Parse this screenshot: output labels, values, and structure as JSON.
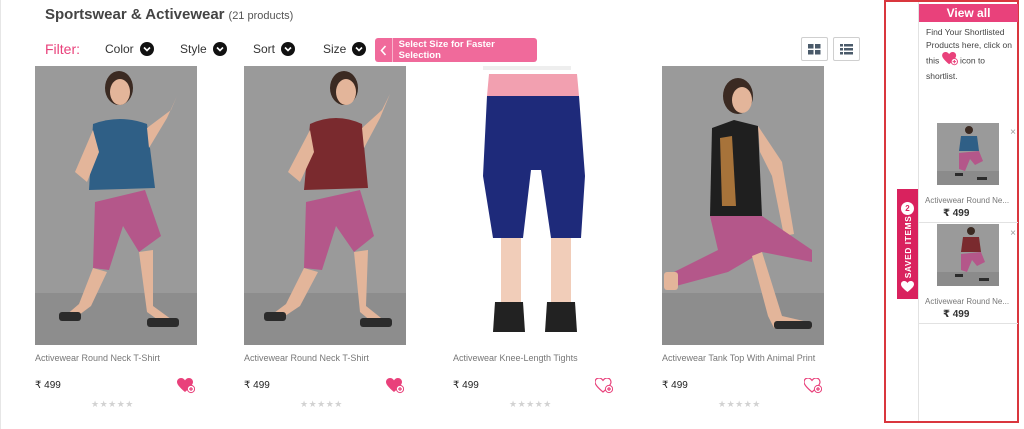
{
  "header": {
    "title": "Sportswear & Activewear",
    "count": "(21 products)"
  },
  "filters": {
    "label": "Filter:",
    "items": [
      "Color",
      "Style",
      "Sort",
      "Size"
    ],
    "size_tip": "Select Size for Faster Selection"
  },
  "view_toggle": {
    "grid_icon": "grid-view-icon",
    "list_icon": "list-view-icon"
  },
  "products": [
    {
      "name": "Activewear Round Neck T-Shirt",
      "price": "₹ 499",
      "rating": "★★★★★",
      "top_color": "#2f5f86",
      "bottom_color": "#b4578a"
    },
    {
      "name": "Activewear Round Neck T-Shirt",
      "price": "₹ 499",
      "rating": "★★★★★",
      "top_color": "#7a2a2e",
      "bottom_color": "#b4578a"
    },
    {
      "name": "Activewear Knee-Length Tights",
      "price": "₹ 499",
      "rating": "★★★★★",
      "top_color": "#f2a0b0",
      "bottom_color": "#1e2a7a"
    },
    {
      "name": "Activewear Tank Top With Animal Print",
      "price": "₹ 499",
      "rating": "★★★★★",
      "top_color": "#1f1f1f",
      "bottom_color": "#b4578a"
    }
  ],
  "shortlist": {
    "view_all": "View all",
    "help_text_1": "Find Your Shortlisted Products here, click on this",
    "help_text_2": "icon to shortlist.",
    "saved_tab_label": "SAVED ITEMS",
    "saved_count": "2",
    "items": [
      {
        "name": "Activewear Round Ne...",
        "price": "₹ 499",
        "remove": "×",
        "top_color": "#2f5f86"
      },
      {
        "name": "Activewear Round Ne...",
        "price": "₹ 499",
        "remove": "×",
        "top_color": "#7a2a2e"
      }
    ]
  },
  "colors": {
    "accent": "#e9417b",
    "panel_border": "#d9363e",
    "saved_tab": "#d9225e"
  }
}
